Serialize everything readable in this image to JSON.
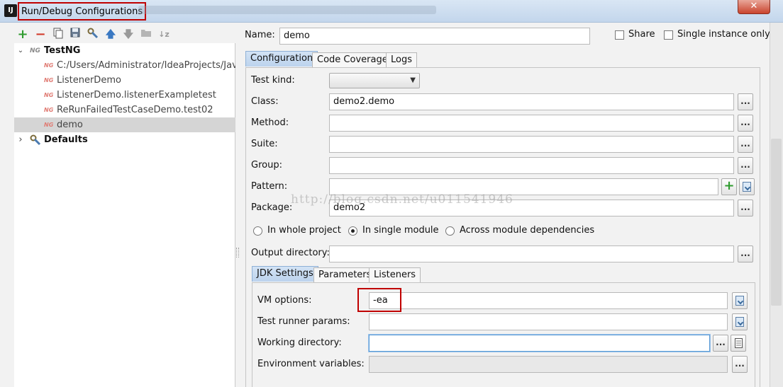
{
  "window": {
    "title": "Run/Debug Configurations",
    "close_symbol": "✕",
    "app_icon_text": "IJ"
  },
  "toolbar": {
    "icons": [
      "add-icon",
      "remove-icon",
      "copy-icon",
      "save-icon",
      "edit-defaults-icon",
      "move-up-icon",
      "move-down-icon",
      "folder-icon",
      "sort-icon"
    ]
  },
  "tree": {
    "root": "TestNG",
    "items": [
      "C:/Users/Administrator/IdeaProjects/Java_L",
      "ListenerDemo",
      "ListenerDemo.listenerExampletest",
      "ReRunFailedTestCaseDemo.test02",
      "demo"
    ],
    "defaults": "Defaults"
  },
  "config": {
    "name_label": "Name:",
    "name_value": "demo",
    "share_label": "Share",
    "single_instance_label": "Single instance only",
    "tabs": [
      "Configuration",
      "Code Coverage",
      "Logs"
    ],
    "test_kind_label": "Test kind:",
    "test_kind_value": "",
    "class_label": "Class:",
    "class_value": "demo2.demo",
    "method_label": "Method:",
    "method_value": "",
    "suite_label": "Suite:",
    "suite_value": "",
    "group_label": "Group:",
    "group_value": "",
    "pattern_label": "Pattern:",
    "pattern_value": "",
    "package_label": "Package:",
    "package_value": "demo2",
    "scope_options": [
      "In whole project",
      "In single module",
      "Across module dependencies"
    ],
    "scope_selected": "In single module",
    "output_dir_label": "Output directory:",
    "output_dir_value": "",
    "browse_label": "..."
  },
  "jdk": {
    "tabs": [
      "JDK Settings",
      "Parameters",
      "Listeners"
    ],
    "vm_options_label": "VM options:",
    "vm_options_value": "-ea",
    "test_runner_label": "Test runner params:",
    "test_runner_value": "",
    "working_dir_label": "Working directory:",
    "working_dir_value": "",
    "env_vars_label": "Environment variables:",
    "env_vars_value": ""
  },
  "watermark": "http://blog.csdn.net/u011541946",
  "colors": {
    "highlight": "#c00000",
    "tab_active": "#bcd3ed",
    "selection": "#d5d5d5"
  }
}
